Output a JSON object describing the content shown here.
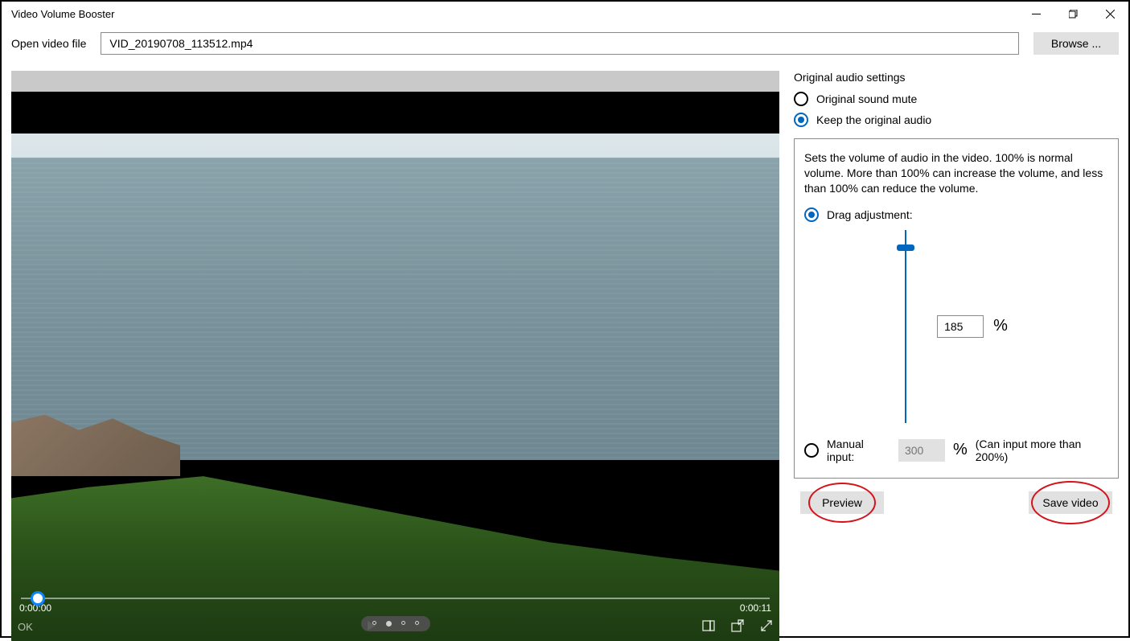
{
  "window": {
    "title": "Video Volume Booster"
  },
  "file": {
    "label": "Open video file",
    "value": "VID_20190708_113512.mp4",
    "browse": "Browse ..."
  },
  "player": {
    "current_time": "0:00:00",
    "duration": "0:00:11",
    "ok": "OK"
  },
  "audio": {
    "section_title": "Original audio settings",
    "mute_label": "Original sound mute",
    "keep_label": "Keep the original audio",
    "selected": "keep"
  },
  "volume": {
    "help": "Sets the volume of audio in the video. 100% is normal volume. More than 100% can increase the volume, and less than 100% can reduce the volume.",
    "drag_label": "Drag adjustment:",
    "drag_value": "185",
    "pct": "%",
    "manual_label": "Manual input:",
    "manual_placeholder": "300",
    "manual_hint": "(Can input more than 200%)",
    "mode": "drag"
  },
  "actions": {
    "preview": "Preview",
    "save": "Save video"
  }
}
